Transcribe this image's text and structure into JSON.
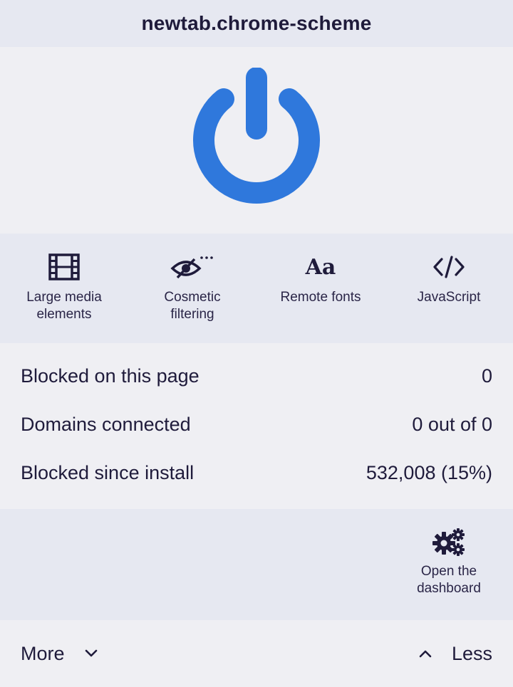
{
  "header": {
    "hostname": "newtab.chrome-scheme"
  },
  "power": {
    "icon": "power-icon",
    "color": "#2f78dc"
  },
  "tools": [
    {
      "icon": "film-icon",
      "label": "Large media\nelements"
    },
    {
      "icon": "eye-slash-icon",
      "label": "Cosmetic\nfiltering"
    },
    {
      "icon": "font-icon",
      "glyph": "Aa",
      "label": "Remote fonts"
    },
    {
      "icon": "code-icon",
      "label": "JavaScript"
    }
  ],
  "stats": [
    {
      "label": "Blocked on this page",
      "value": "0"
    },
    {
      "label": "Domains connected",
      "value": "0 out of 0"
    },
    {
      "label": "Blocked since install",
      "value": "532,008 (15%)"
    }
  ],
  "dashboard": {
    "icon": "gears-icon",
    "label": "Open the\ndashboard"
  },
  "footer": {
    "more_label": "More",
    "less_label": "Less"
  },
  "colors": {
    "accent": "#2f78dc",
    "text": "#1f1b3b",
    "panel": "#e6e8f1",
    "background": "#efeff3"
  }
}
